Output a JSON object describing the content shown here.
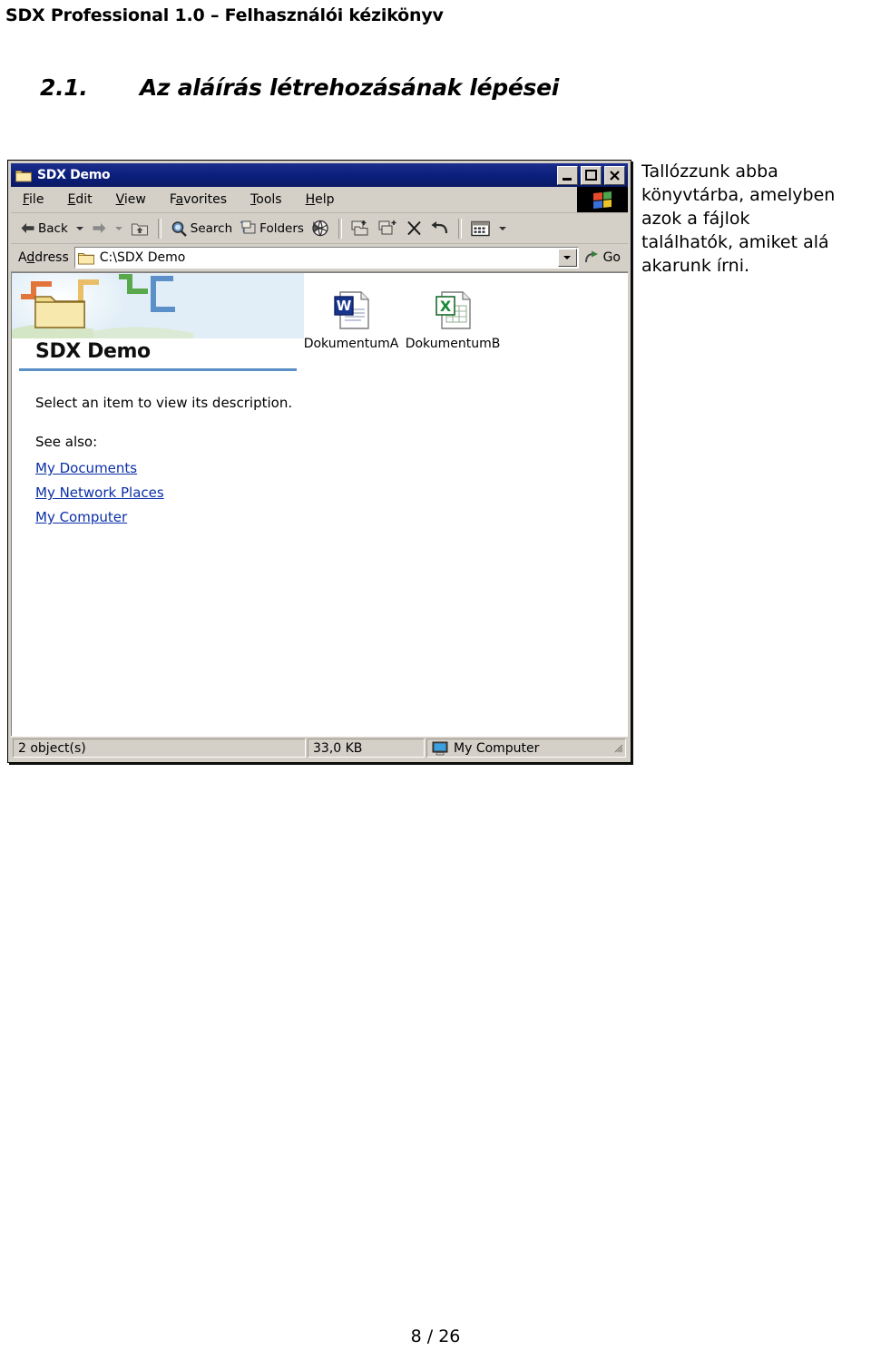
{
  "page": {
    "header": "SDX Professional 1.0 – Felhasználói kézikönyv",
    "footer": "8 / 26"
  },
  "heading": {
    "number": "2.1.",
    "text": "Az aláírás létrehozásának lépései"
  },
  "body_text": {
    "line1": "Tallózzunk abba",
    "line2": "könyvtárba, amelyben",
    "line3": "azok a fájlok",
    "line4": "találhatók, amiket alá",
    "line5": "akarunk írni.",
    "full": "Tallózzunk abba könyvtárba, amelyben azok a fájlok találhatók, amiket alá akarunk írni."
  },
  "explorer": {
    "title": "SDX Demo",
    "titlebar_icon": "folder-icon",
    "window_buttons": {
      "minimize": "minimize-button",
      "maximize": "maximize-button",
      "close": "close-button"
    },
    "menu": [
      {
        "pre": "",
        "hot": "F",
        "post": "ile",
        "label": "File"
      },
      {
        "pre": "",
        "hot": "E",
        "post": "dit",
        "label": "Edit"
      },
      {
        "pre": "",
        "hot": "V",
        "post": "iew",
        "label": "View"
      },
      {
        "pre": "F",
        "hot": "a",
        "post": "vorites",
        "label": "Favorites"
      },
      {
        "pre": "",
        "hot": "T",
        "post": "ools",
        "label": "Tools"
      },
      {
        "pre": "",
        "hot": "H",
        "post": "elp",
        "label": "Help"
      }
    ],
    "toolbar": {
      "back": "Back",
      "forward": "",
      "up": "",
      "search": "Search",
      "folders": "Folders",
      "history": "",
      "move_to": "",
      "copy_to": "",
      "delete": "",
      "undo": "",
      "views": ""
    },
    "address": {
      "label_pre": "A",
      "label_hot": "d",
      "label_post": "dress",
      "label": "Address",
      "value": "C:\\SDX Demo",
      "go": "Go"
    },
    "task_pane": {
      "title": "SDX Demo",
      "description": "Select an item to view its description.",
      "see_also_label": "See also:",
      "links": [
        "My Documents",
        "My Network Places",
        "My Computer"
      ]
    },
    "files": [
      {
        "name": "DokumentumA",
        "icon": "word-document-icon"
      },
      {
        "name": "DokumentumB",
        "icon": "excel-document-icon"
      }
    ],
    "status": {
      "objects": "2 object(s)",
      "size": "33,0 KB",
      "location": "My Computer",
      "location_icon": "my-computer-icon"
    }
  },
  "colors": {
    "titlebar_blue": "#0b1f7c",
    "link_blue": "#0b2fa8",
    "chrome_gray": "#d4d0c8",
    "rule_blue": "#5b8fc7"
  }
}
